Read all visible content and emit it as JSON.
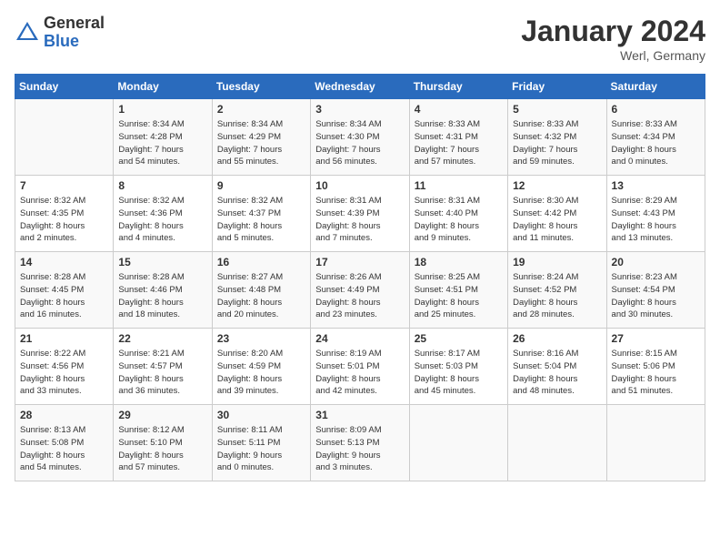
{
  "logo": {
    "text_general": "General",
    "text_blue": "Blue"
  },
  "title": "January 2024",
  "location": "Werl, Germany",
  "days_of_week": [
    "Sunday",
    "Monday",
    "Tuesday",
    "Wednesday",
    "Thursday",
    "Friday",
    "Saturday"
  ],
  "weeks": [
    [
      {
        "day": "",
        "info": ""
      },
      {
        "day": "1",
        "info": "Sunrise: 8:34 AM\nSunset: 4:28 PM\nDaylight: 7 hours\nand 54 minutes."
      },
      {
        "day": "2",
        "info": "Sunrise: 8:34 AM\nSunset: 4:29 PM\nDaylight: 7 hours\nand 55 minutes."
      },
      {
        "day": "3",
        "info": "Sunrise: 8:34 AM\nSunset: 4:30 PM\nDaylight: 7 hours\nand 56 minutes."
      },
      {
        "day": "4",
        "info": "Sunrise: 8:33 AM\nSunset: 4:31 PM\nDaylight: 7 hours\nand 57 minutes."
      },
      {
        "day": "5",
        "info": "Sunrise: 8:33 AM\nSunset: 4:32 PM\nDaylight: 7 hours\nand 59 minutes."
      },
      {
        "day": "6",
        "info": "Sunrise: 8:33 AM\nSunset: 4:34 PM\nDaylight: 8 hours\nand 0 minutes."
      }
    ],
    [
      {
        "day": "7",
        "info": "Sunrise: 8:32 AM\nSunset: 4:35 PM\nDaylight: 8 hours\nand 2 minutes."
      },
      {
        "day": "8",
        "info": "Sunrise: 8:32 AM\nSunset: 4:36 PM\nDaylight: 8 hours\nand 4 minutes."
      },
      {
        "day": "9",
        "info": "Sunrise: 8:32 AM\nSunset: 4:37 PM\nDaylight: 8 hours\nand 5 minutes."
      },
      {
        "day": "10",
        "info": "Sunrise: 8:31 AM\nSunset: 4:39 PM\nDaylight: 8 hours\nand 7 minutes."
      },
      {
        "day": "11",
        "info": "Sunrise: 8:31 AM\nSunset: 4:40 PM\nDaylight: 8 hours\nand 9 minutes."
      },
      {
        "day": "12",
        "info": "Sunrise: 8:30 AM\nSunset: 4:42 PM\nDaylight: 8 hours\nand 11 minutes."
      },
      {
        "day": "13",
        "info": "Sunrise: 8:29 AM\nSunset: 4:43 PM\nDaylight: 8 hours\nand 13 minutes."
      }
    ],
    [
      {
        "day": "14",
        "info": "Sunrise: 8:28 AM\nSunset: 4:45 PM\nDaylight: 8 hours\nand 16 minutes."
      },
      {
        "day": "15",
        "info": "Sunrise: 8:28 AM\nSunset: 4:46 PM\nDaylight: 8 hours\nand 18 minutes."
      },
      {
        "day": "16",
        "info": "Sunrise: 8:27 AM\nSunset: 4:48 PM\nDaylight: 8 hours\nand 20 minutes."
      },
      {
        "day": "17",
        "info": "Sunrise: 8:26 AM\nSunset: 4:49 PM\nDaylight: 8 hours\nand 23 minutes."
      },
      {
        "day": "18",
        "info": "Sunrise: 8:25 AM\nSunset: 4:51 PM\nDaylight: 8 hours\nand 25 minutes."
      },
      {
        "day": "19",
        "info": "Sunrise: 8:24 AM\nSunset: 4:52 PM\nDaylight: 8 hours\nand 28 minutes."
      },
      {
        "day": "20",
        "info": "Sunrise: 8:23 AM\nSunset: 4:54 PM\nDaylight: 8 hours\nand 30 minutes."
      }
    ],
    [
      {
        "day": "21",
        "info": "Sunrise: 8:22 AM\nSunset: 4:56 PM\nDaylight: 8 hours\nand 33 minutes."
      },
      {
        "day": "22",
        "info": "Sunrise: 8:21 AM\nSunset: 4:57 PM\nDaylight: 8 hours\nand 36 minutes."
      },
      {
        "day": "23",
        "info": "Sunrise: 8:20 AM\nSunset: 4:59 PM\nDaylight: 8 hours\nand 39 minutes."
      },
      {
        "day": "24",
        "info": "Sunrise: 8:19 AM\nSunset: 5:01 PM\nDaylight: 8 hours\nand 42 minutes."
      },
      {
        "day": "25",
        "info": "Sunrise: 8:17 AM\nSunset: 5:03 PM\nDaylight: 8 hours\nand 45 minutes."
      },
      {
        "day": "26",
        "info": "Sunrise: 8:16 AM\nSunset: 5:04 PM\nDaylight: 8 hours\nand 48 minutes."
      },
      {
        "day": "27",
        "info": "Sunrise: 8:15 AM\nSunset: 5:06 PM\nDaylight: 8 hours\nand 51 minutes."
      }
    ],
    [
      {
        "day": "28",
        "info": "Sunrise: 8:13 AM\nSunset: 5:08 PM\nDaylight: 8 hours\nand 54 minutes."
      },
      {
        "day": "29",
        "info": "Sunrise: 8:12 AM\nSunset: 5:10 PM\nDaylight: 8 hours\nand 57 minutes."
      },
      {
        "day": "30",
        "info": "Sunrise: 8:11 AM\nSunset: 5:11 PM\nDaylight: 9 hours\nand 0 minutes."
      },
      {
        "day": "31",
        "info": "Sunrise: 8:09 AM\nSunset: 5:13 PM\nDaylight: 9 hours\nand 3 minutes."
      },
      {
        "day": "",
        "info": ""
      },
      {
        "day": "",
        "info": ""
      },
      {
        "day": "",
        "info": ""
      }
    ]
  ]
}
